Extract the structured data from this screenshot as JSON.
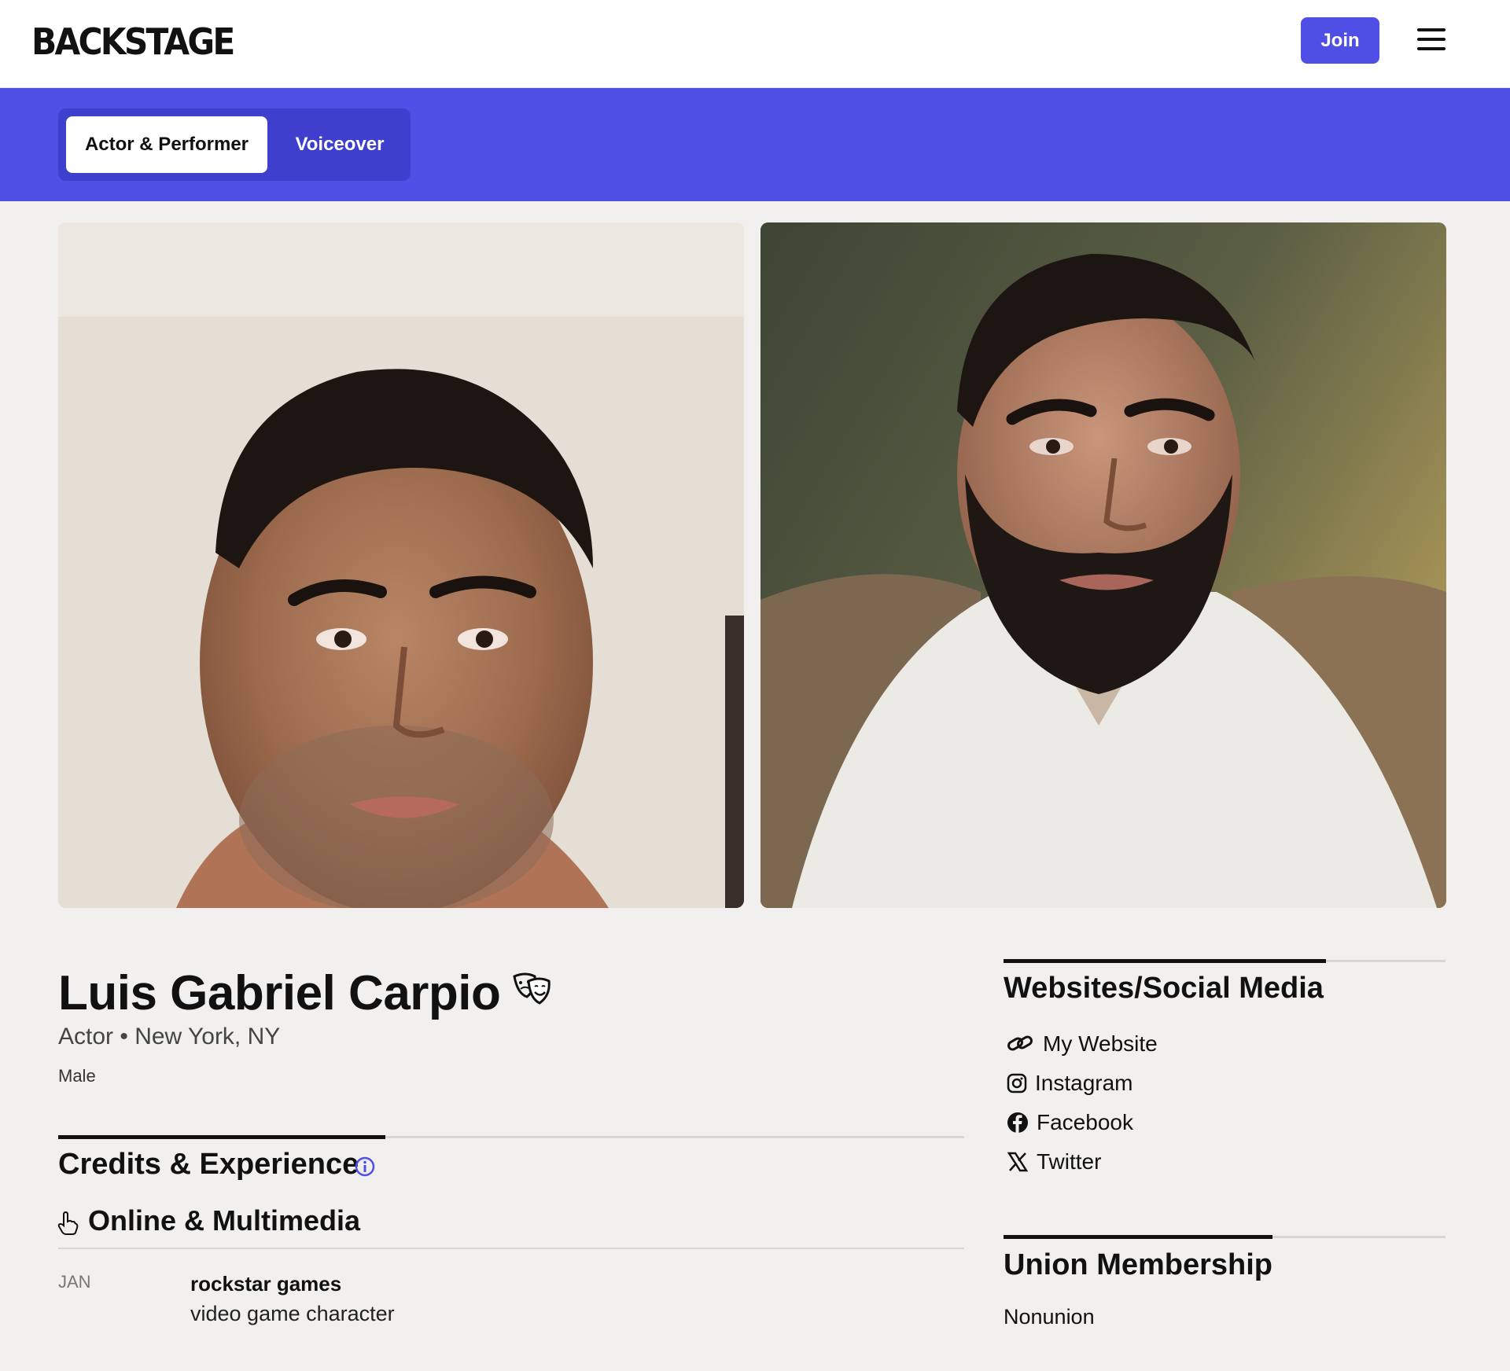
{
  "header": {
    "logo": "BACKSTAGE",
    "join_label": "Join"
  },
  "tabs": [
    {
      "label": "Actor & Performer",
      "active": true
    },
    {
      "label": "Voiceover",
      "active": false
    }
  ],
  "profile": {
    "name": "Luis Gabriel Carpio",
    "role": "Actor",
    "location": "New York, NY",
    "subtitle": "Actor • New York, NY",
    "gender": "Male"
  },
  "credits": {
    "title": "Credits & Experience",
    "category": "Online & Multimedia",
    "items": [
      {
        "month": "JAN",
        "company": "rockstar games",
        "role": "video game character"
      }
    ]
  },
  "social": {
    "title": "Websites/Social Media",
    "links": [
      {
        "label": "My Website",
        "icon": "link-icon"
      },
      {
        "label": "Instagram",
        "icon": "instagram-icon"
      },
      {
        "label": "Facebook",
        "icon": "facebook-icon"
      },
      {
        "label": "Twitter",
        "icon": "x-icon"
      }
    ]
  },
  "union": {
    "title": "Union Membership",
    "value": "Nonunion"
  },
  "colors": {
    "brand_purple": "#4f50e6",
    "tab_container": "#3e3fcc",
    "page_background": "#f1f0ee"
  }
}
